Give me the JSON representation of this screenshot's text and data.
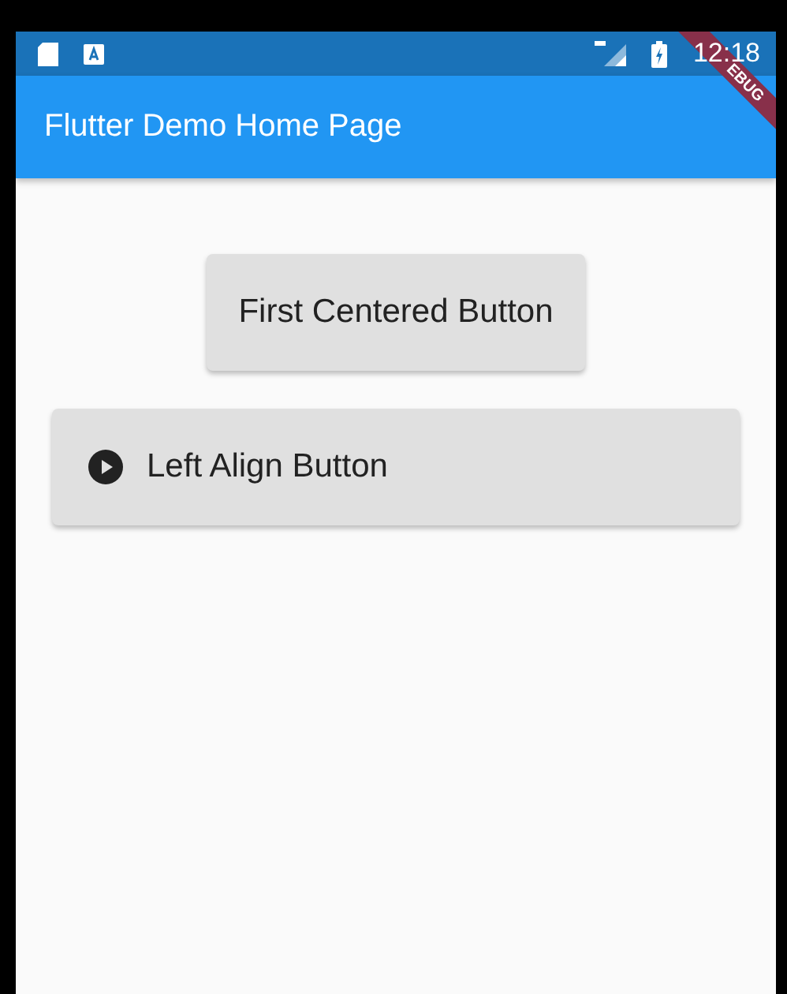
{
  "status_bar": {
    "time": "12:18"
  },
  "debug_banner": "EBUG",
  "app_bar": {
    "title": "Flutter Demo Home Page"
  },
  "buttons": [
    {
      "label": "First Centered Button",
      "kind": "centered"
    },
    {
      "label": "Left Align Button",
      "kind": "left-icon"
    }
  ]
}
